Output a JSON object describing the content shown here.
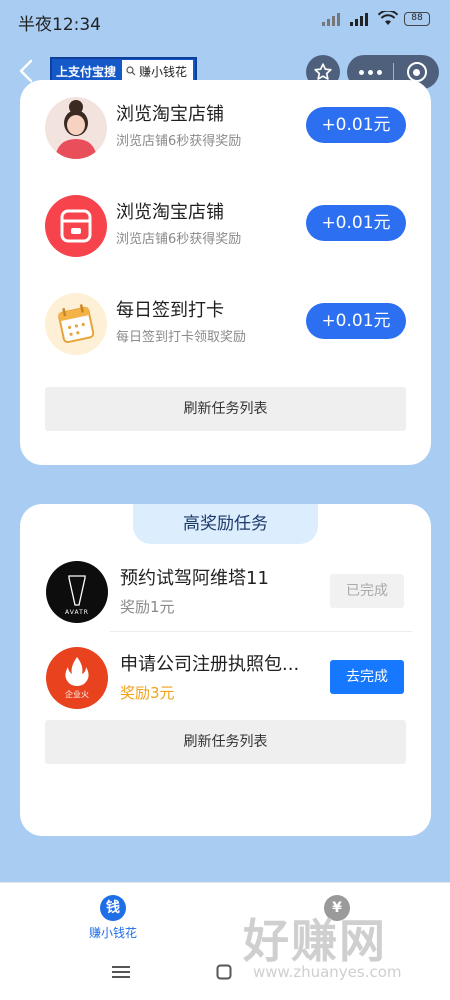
{
  "status_bar": {
    "time": "半夜12:34",
    "battery": "88"
  },
  "nav": {
    "search_tag_prefix": "上支付宝搜",
    "search_tag_keyword": "赚小钱花"
  },
  "tasks": [
    {
      "title": "浏览淘宝店铺",
      "desc": "浏览店铺6秒获得奖励",
      "reward": "+0.01元",
      "icon": "girl-avatar-icon"
    },
    {
      "title": "浏览淘宝店铺",
      "desc": "浏览店铺6秒获得奖励",
      "reward": "+0.01元",
      "icon": "shop-icon"
    },
    {
      "title": "每日签到打卡",
      "desc": "每日签到打卡领取奖励",
      "reward": "+0.01元",
      "icon": "calendar-icon"
    }
  ],
  "refresh_label": "刷新任务列表",
  "high_reward": {
    "section_title": "高奖励任务",
    "items": [
      {
        "title": "预约试驾阿维塔11",
        "reward": "奖励1元",
        "action": "已完成",
        "logo_text": "AVATR",
        "reward_color": "#8a8a8a"
      },
      {
        "title": "申请公司注册执照包...",
        "reward": "奖励3元",
        "action": "去完成",
        "logo_text": "企业火",
        "reward_color": "#f0a21a"
      }
    ],
    "refresh_label": "刷新任务列表"
  },
  "tabbar": {
    "items": [
      {
        "label": "赚小钱花",
        "icon_char": "钱",
        "active": true
      },
      {
        "label": "",
        "icon_char": "¥",
        "active": false
      }
    ]
  },
  "watermark": {
    "text": "好赚网",
    "sub": "www.zhuanyes.com"
  },
  "colors": {
    "primary": "#2c6ff0",
    "background": "#a9ccf3",
    "accent_orange": "#f0a21a"
  }
}
